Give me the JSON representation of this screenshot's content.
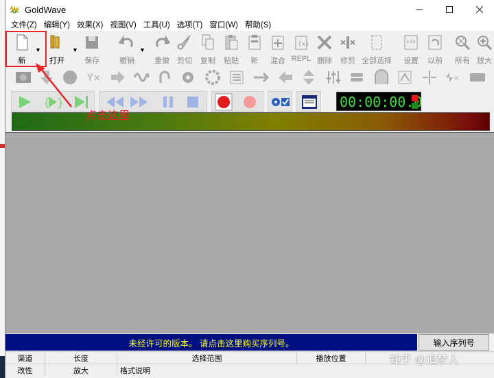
{
  "window": {
    "title": "GoldWave"
  },
  "menu": [
    "文件(Z)",
    "编辑(Y)",
    "效果(X)",
    "视图(V)",
    "工具(U)",
    "选项(T)",
    "窗口(W)",
    "帮助(S)"
  ],
  "toolbar": [
    {
      "name": "new",
      "label": "新",
      "active": true
    },
    {
      "name": "open",
      "label": "打开",
      "active": true
    },
    {
      "name": "save",
      "label": "保存"
    },
    {
      "name": "undo",
      "label": "撤销"
    },
    {
      "name": "redo",
      "label": "重做"
    },
    {
      "name": "cut",
      "label": "剪切"
    },
    {
      "name": "copy",
      "label": "复制"
    },
    {
      "name": "paste",
      "label": "粘贴"
    },
    {
      "name": "new2",
      "label": "新"
    },
    {
      "name": "mix",
      "label": "混合"
    },
    {
      "name": "repl",
      "label": "REPL"
    },
    {
      "name": "delete",
      "label": "删除"
    },
    {
      "name": "trim",
      "label": "修剪"
    },
    {
      "name": "select-all",
      "label": "全部选择"
    },
    {
      "name": "settings",
      "label": "设置"
    },
    {
      "name": "previous",
      "label": "以前"
    },
    {
      "name": "all",
      "label": "所有"
    },
    {
      "name": "zoom-in",
      "label": "放大"
    }
  ],
  "transport": {
    "time": "00:00:00.0"
  },
  "promo": {
    "text": "未经许可的版本。 请点击这里购买序列号。",
    "serial_button": "输入序列号"
  },
  "status": {
    "row1": [
      "渠道",
      "长度",
      "选择范围",
      "播放位置"
    ],
    "row2": [
      "改性",
      "放大",
      "格式说明"
    ]
  },
  "annotation": "点击这里",
  "watermark": "知乎 @追梦人",
  "colors": {
    "time_green": "#3fe03f",
    "promo_bg": "#001080",
    "promo_text": "#ffff33",
    "annotation_red": "#e8242b"
  }
}
